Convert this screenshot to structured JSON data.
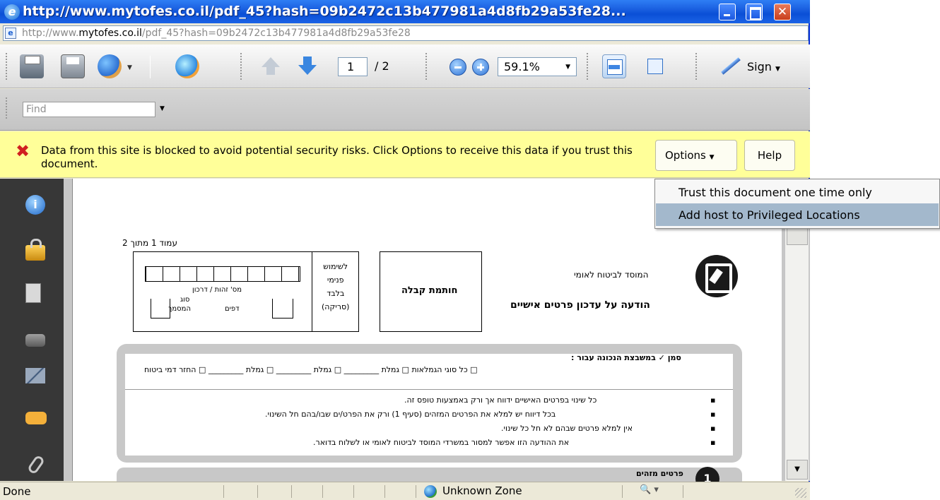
{
  "window": {
    "title": "http://www.mytofes.co.il/pdf_45?hash=09b2472c13b477981a4d8fb29a53fe28..."
  },
  "address": {
    "prefix": "http://www.",
    "domain": "mytofes.co.il",
    "path": "/pdf_45?hash=09b2472c13b477981a4d8fb29a53fe28"
  },
  "toolbar": {
    "page_current": "1",
    "page_total": "/ 2",
    "zoom": "59.1%",
    "sign_label": "Sign"
  },
  "find": {
    "placeholder": "Find"
  },
  "security_bar": {
    "message": "Data from this site is blocked to avoid potential security risks. Click Options to receive this data if you trust this document.",
    "options_label": "Options",
    "help_label": "Help"
  },
  "options_menu": {
    "items": [
      {
        "label": "Trust this document one time only"
      },
      {
        "label": "Add host to Privileged Locations"
      }
    ]
  },
  "document": {
    "page_number": "עמוד 1 מתוך 2",
    "internal_use": [
      "לשימוש",
      "פנימי",
      "בלבד",
      "(סריקה)"
    ],
    "id_label": "מס' זהות / דרכון",
    "doc_type_label": "סוג",
    "doc_type_label2": "המסמך",
    "pages_label": "דפים",
    "receipt_stamp": "חותמת קבלה",
    "institute_name": "המוסד לביטוח לאומי",
    "form_title": "הודעה על עדכון פרטים אישיים",
    "mark_instruction": "סמן ✓ במשבצת הנכונה עבור :",
    "checkbox_row": "□ כל סוגי הגמלאות □ גמלת _________ □ גמלת _________ □ גמלת _________ □ החזר דמי ביטוח",
    "bullets": [
      "כל שינוי בפרטים האישיים ידווח אך ורק באמצעות טופס זה.",
      "בכל דיווח יש למלא את הפרטים המזהים (סעיף 1) ורק את הפרט/ים שבו/בהם חל השינוי.",
      "אין למלא פרטים שבהם לא חל כל שינוי.",
      "את ההודעה הזו אפשר למסור במשרדי המוסד לביטוח לאומי או לשלוח בדואר."
    ],
    "section1_title": "פרטים מזהים",
    "section1_num": "1"
  },
  "status": {
    "text": "Done",
    "zone": "Unknown Zone"
  }
}
